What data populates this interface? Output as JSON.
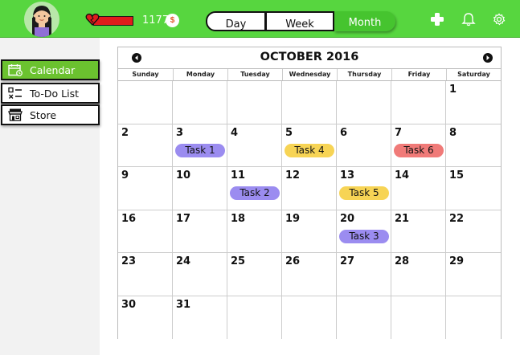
{
  "colors": {
    "header_green": "#57d63f",
    "active_nav": "#6bc22f",
    "health": "#e01c1c",
    "task_purple": "#9b8cf0",
    "task_yellow": "#f7d455",
    "task_red": "#f07a78"
  },
  "header": {
    "coins": "1177",
    "coin_symbol": "$",
    "tabs": [
      "Day",
      "Week",
      "Month"
    ],
    "active_tab": "Month",
    "health_fraction": 0.9
  },
  "sidebar": {
    "items": [
      {
        "label": "Calendar",
        "icon": "calendar-icon",
        "active": true
      },
      {
        "label": "To-Do List",
        "icon": "checklist-icon",
        "active": false
      },
      {
        "label": "Store",
        "icon": "store-icon",
        "active": false
      }
    ]
  },
  "calendar": {
    "title": "OCTOBER 2016",
    "weekdays": [
      "Sunday",
      "Monday",
      "Tuesday",
      "Wednesday",
      "Thursday",
      "Friday",
      "Saturday"
    ],
    "first_weekday_index": 6,
    "days_in_month": 31,
    "tasks": [
      {
        "day": 3,
        "label": "Task 1",
        "color": "#9b8cf0"
      },
      {
        "day": 5,
        "label": "Task 4",
        "color": "#f7d455"
      },
      {
        "day": 7,
        "label": "Task 6",
        "color": "#f07a78"
      },
      {
        "day": 11,
        "label": "Task 2",
        "color": "#9b8cf0"
      },
      {
        "day": 13,
        "label": "Task 5",
        "color": "#f7d455"
      },
      {
        "day": 20,
        "label": "Task 3",
        "color": "#9b8cf0"
      }
    ]
  }
}
